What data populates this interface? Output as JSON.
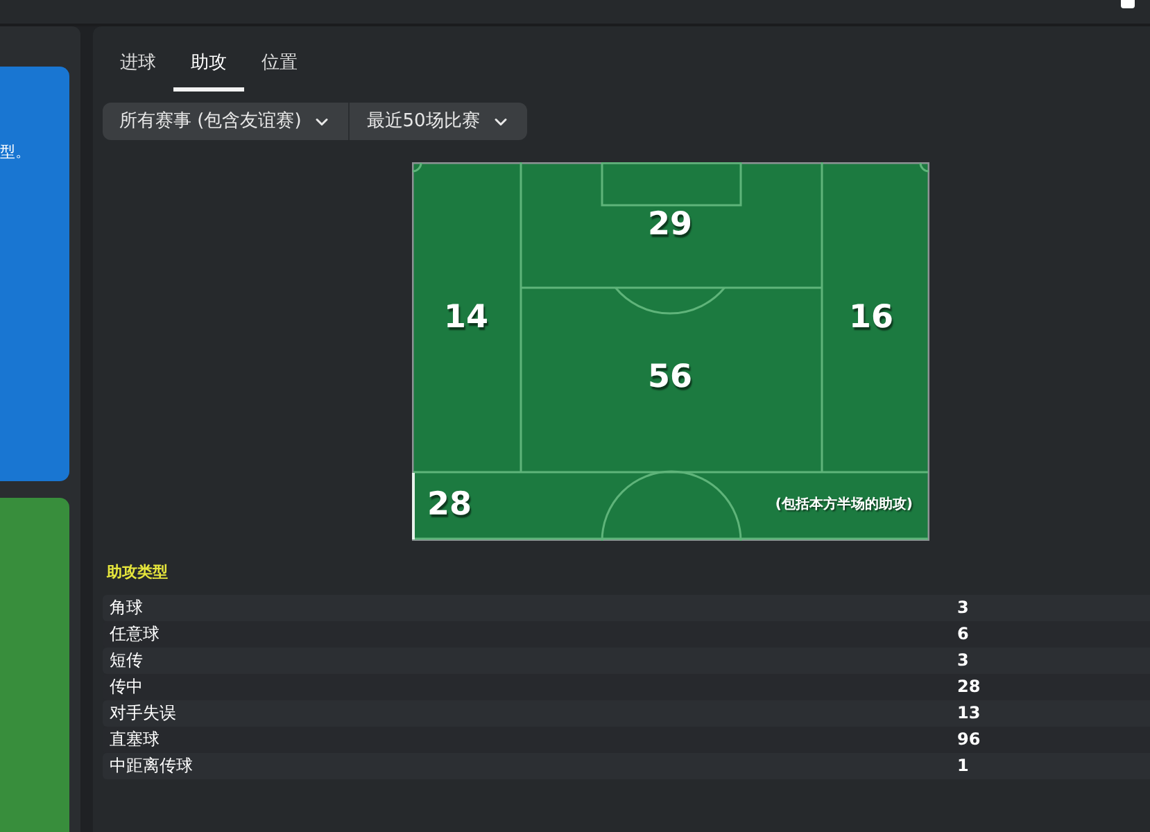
{
  "left_panel": {
    "info_card_text": "型。"
  },
  "tabs": [
    {
      "label": "进球",
      "selected": false
    },
    {
      "label": "助攻",
      "selected": true
    },
    {
      "label": "位置",
      "selected": false
    }
  ],
  "filters": [
    {
      "value": "所有赛事 (包含友谊赛)"
    },
    {
      "value": "最近50场比赛"
    }
  ],
  "pitch": {
    "zones": [
      {
        "kind": "box",
        "value": "29"
      },
      {
        "kind": "leftwing",
        "value": "14"
      },
      {
        "kind": "rightwing",
        "value": "16"
      },
      {
        "kind": "center",
        "value": "56"
      },
      {
        "kind": "ownhalf",
        "value": "28",
        "note": "(包括本方半场的助攻)"
      }
    ]
  },
  "assist_types": {
    "title": "助攻类型",
    "rows": [
      {
        "label": "角球",
        "value": "3"
      },
      {
        "label": "任意球",
        "value": "6"
      },
      {
        "label": "短传",
        "value": "3"
      },
      {
        "label": "传中",
        "value": "28"
      },
      {
        "label": "对手失误",
        "value": "13"
      },
      {
        "label": "直塞球",
        "value": "96"
      },
      {
        "label": "中距离传球",
        "value": "1"
      }
    ]
  }
}
